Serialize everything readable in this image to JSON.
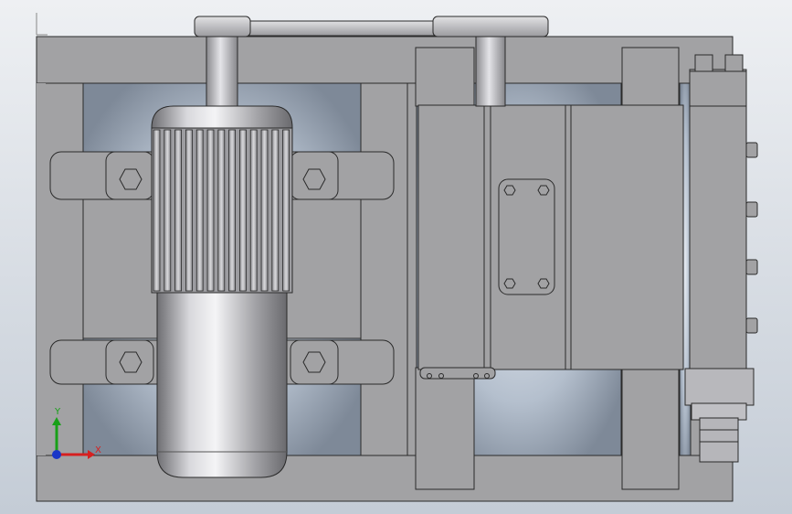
{
  "view": {
    "background_top": "#eef0f3",
    "background_bottom": "#c4ccd6",
    "part_fill": "#a2a2a4",
    "part_stroke": "#2a2a2a",
    "recess_fill": "#8c97a6"
  },
  "triad": {
    "x_label": "X",
    "y_label": "Y",
    "x_color": "#d62020",
    "y_color": "#18a018",
    "z_color": "#1a36c8"
  }
}
